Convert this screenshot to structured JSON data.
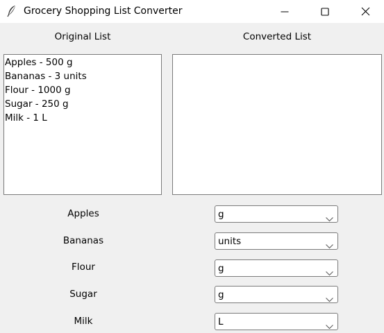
{
  "window": {
    "title": "Grocery Shopping List Converter"
  },
  "headers": {
    "original": "Original List",
    "converted": "Converted List"
  },
  "original_list": [
    "Apples - 500 g",
    "Bananas - 3 units",
    "Flour - 1000 g",
    "Sugar - 250 g",
    "Milk - 1 L"
  ],
  "converted_list": [],
  "items": [
    {
      "label": "Apples",
      "unit": "g"
    },
    {
      "label": "Bananas",
      "unit": "units"
    },
    {
      "label": "Flour",
      "unit": "g"
    },
    {
      "label": "Sugar",
      "unit": "g"
    },
    {
      "label": "Milk",
      "unit": "L"
    }
  ],
  "icons": {
    "app": "feather-icon",
    "minimize": "minimize-icon",
    "maximize": "maximize-icon",
    "close": "close-icon",
    "dropdown": "chevron-down-icon"
  }
}
